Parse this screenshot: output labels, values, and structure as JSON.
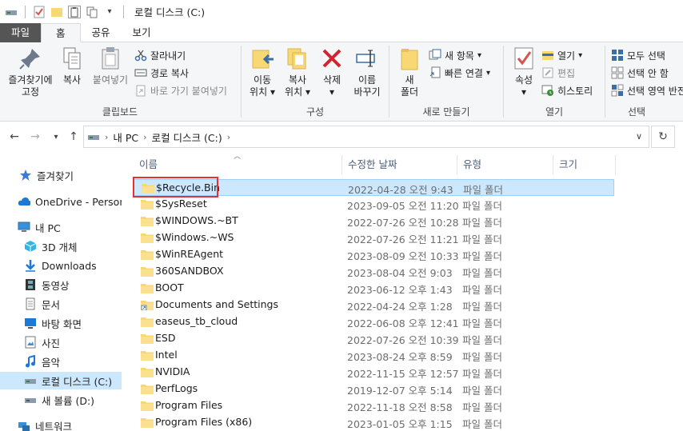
{
  "window": {
    "title": "로컬 디스크 (C:)"
  },
  "tabs": [
    {
      "label": "파일"
    },
    {
      "label": "홈"
    },
    {
      "label": "공유"
    },
    {
      "label": "보기"
    }
  ],
  "ribbon": {
    "clipboard": {
      "label": "클립보드",
      "pin": "즐겨찾기에\n고정",
      "pin_l1": "즐겨찾기에",
      "pin_l2": "고정",
      "copy": "복사",
      "paste": "붙여넣기",
      "cut": "잘라내기",
      "copy_path": "경로 복사",
      "paste_shortcut": "바로 가기 붙여넣기"
    },
    "organize": {
      "label": "구성",
      "move_l1": "이동",
      "move_l2": "위치",
      "copyto_l1": "복사",
      "copyto_l2": "위치",
      "delete": "삭제",
      "rename_l1": "이름",
      "rename_l2": "바꾸기"
    },
    "new": {
      "label": "새로 만들기",
      "folder_l1": "새",
      "folder_l2": "폴더",
      "new_item": "새 항목",
      "easy_access": "빠른 연결"
    },
    "open": {
      "label": "열기",
      "properties": "속성",
      "open": "열기",
      "edit": "편집",
      "history": "히스토리"
    },
    "select": {
      "label": "선택",
      "select_all": "모두 선택",
      "select_none": "선택 안 함",
      "invert": "선택 영역 반전"
    }
  },
  "address": {
    "crumbs": [
      "내 PC",
      "로컬 디스크 (C:)"
    ]
  },
  "navpane": {
    "items": [
      {
        "label": "즐겨찾기",
        "icon": "star-icon"
      },
      {
        "label": "OneDrive - Personal",
        "icon": "cloud-icon"
      },
      {
        "label": "내 PC",
        "icon": "computer-icon"
      },
      {
        "label": "3D 개체",
        "icon": "cube-icon"
      },
      {
        "label": "Downloads",
        "icon": "download-icon"
      },
      {
        "label": "동영상",
        "icon": "film-icon"
      },
      {
        "label": "문서",
        "icon": "document-icon"
      },
      {
        "label": "바탕 화면",
        "icon": "desktop-icon"
      },
      {
        "label": "사진",
        "icon": "picture-icon"
      },
      {
        "label": "음악",
        "icon": "music-icon"
      },
      {
        "label": "로컬 디스크 (C:)",
        "icon": "drive-icon"
      },
      {
        "label": "새 볼륨 (D:)",
        "icon": "drive-icon"
      },
      {
        "label": "네트워크",
        "icon": "network-icon"
      }
    ]
  },
  "columns": {
    "name": "이름",
    "modified": "수정한 날짜",
    "type": "유형",
    "size": "크기"
  },
  "files": [
    {
      "name": "$Recycle.Bin",
      "date": "2022-04-28 오전 9:43",
      "type": "파일 폴더"
    },
    {
      "name": "$SysReset",
      "date": "2023-09-05 오전 11:20",
      "type": "파일 폴더"
    },
    {
      "name": "$WINDOWS.~BT",
      "date": "2022-07-26 오전 10:28",
      "type": "파일 폴더"
    },
    {
      "name": "$Windows.~WS",
      "date": "2022-07-26 오전 11:21",
      "type": "파일 폴더"
    },
    {
      "name": "$WinREAgent",
      "date": "2023-08-09 오전 10:33",
      "type": "파일 폴더"
    },
    {
      "name": "360SANDBOX",
      "date": "2023-08-04 오전 9:03",
      "type": "파일 폴더"
    },
    {
      "name": "BOOT",
      "date": "2023-06-12 오후 1:43",
      "type": "파일 폴더"
    },
    {
      "name": "Documents and Settings",
      "date": "2022-04-24 오후 1:28",
      "type": "파일 폴더"
    },
    {
      "name": "easeus_tb_cloud",
      "date": "2022-06-08 오후 12:41",
      "type": "파일 폴더"
    },
    {
      "name": "ESD",
      "date": "2022-07-26 오전 10:39",
      "type": "파일 폴더"
    },
    {
      "name": "Intel",
      "date": "2023-08-24 오후 8:59",
      "type": "파일 폴더"
    },
    {
      "name": "NVIDIA",
      "date": "2022-11-15 오후 12:57",
      "type": "파일 폴더"
    },
    {
      "name": "PerfLogs",
      "date": "2019-12-07 오후 5:14",
      "type": "파일 폴더"
    },
    {
      "name": "Program Files",
      "date": "2022-11-18 오전 8:58",
      "type": "파일 폴더"
    },
    {
      "name": "Program Files (x86)",
      "date": "2023-01-05 오후 1:15",
      "type": "파일 폴더"
    }
  ],
  "colors": {
    "selection": "#cce8ff",
    "highlight": "#e8312f",
    "folder": "#f8d775"
  }
}
